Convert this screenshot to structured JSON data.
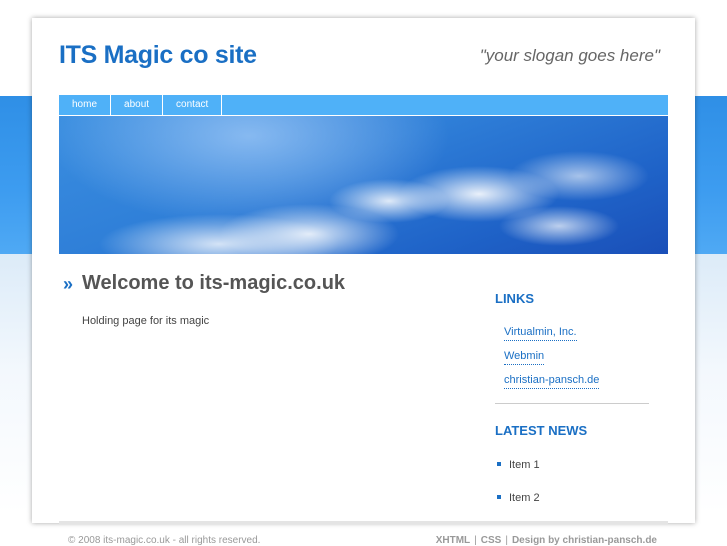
{
  "header": {
    "site_title": "ITS Magic co site",
    "slogan": "\"your slogan goes here\""
  },
  "nav": {
    "items": [
      {
        "label": "home"
      },
      {
        "label": "about"
      },
      {
        "label": "contact"
      }
    ]
  },
  "main": {
    "arrow": "»",
    "title": "Welcome to its-magic.co.uk",
    "text": "Holding page for its magic"
  },
  "sidebar": {
    "links_heading": "LINKS",
    "links": [
      {
        "label": "Virtualmin, Inc."
      },
      {
        "label": "Webmin"
      },
      {
        "label": "christian-pansch.de"
      }
    ],
    "news_heading": "LATEST NEWS",
    "news": [
      {
        "label": "Item 1"
      },
      {
        "label": "Item 2"
      }
    ]
  },
  "footer": {
    "copyright": "© 2008 its-magic.co.uk - all rights reserved.",
    "xhtml": "XHTML",
    "separator": "|",
    "css": "CSS",
    "design_credit": "Design by christian-pansch.de"
  },
  "colors": {
    "accent": "#1a6fc4",
    "nav_bg": "#4fb1f8",
    "band": "#3d9cf0"
  }
}
